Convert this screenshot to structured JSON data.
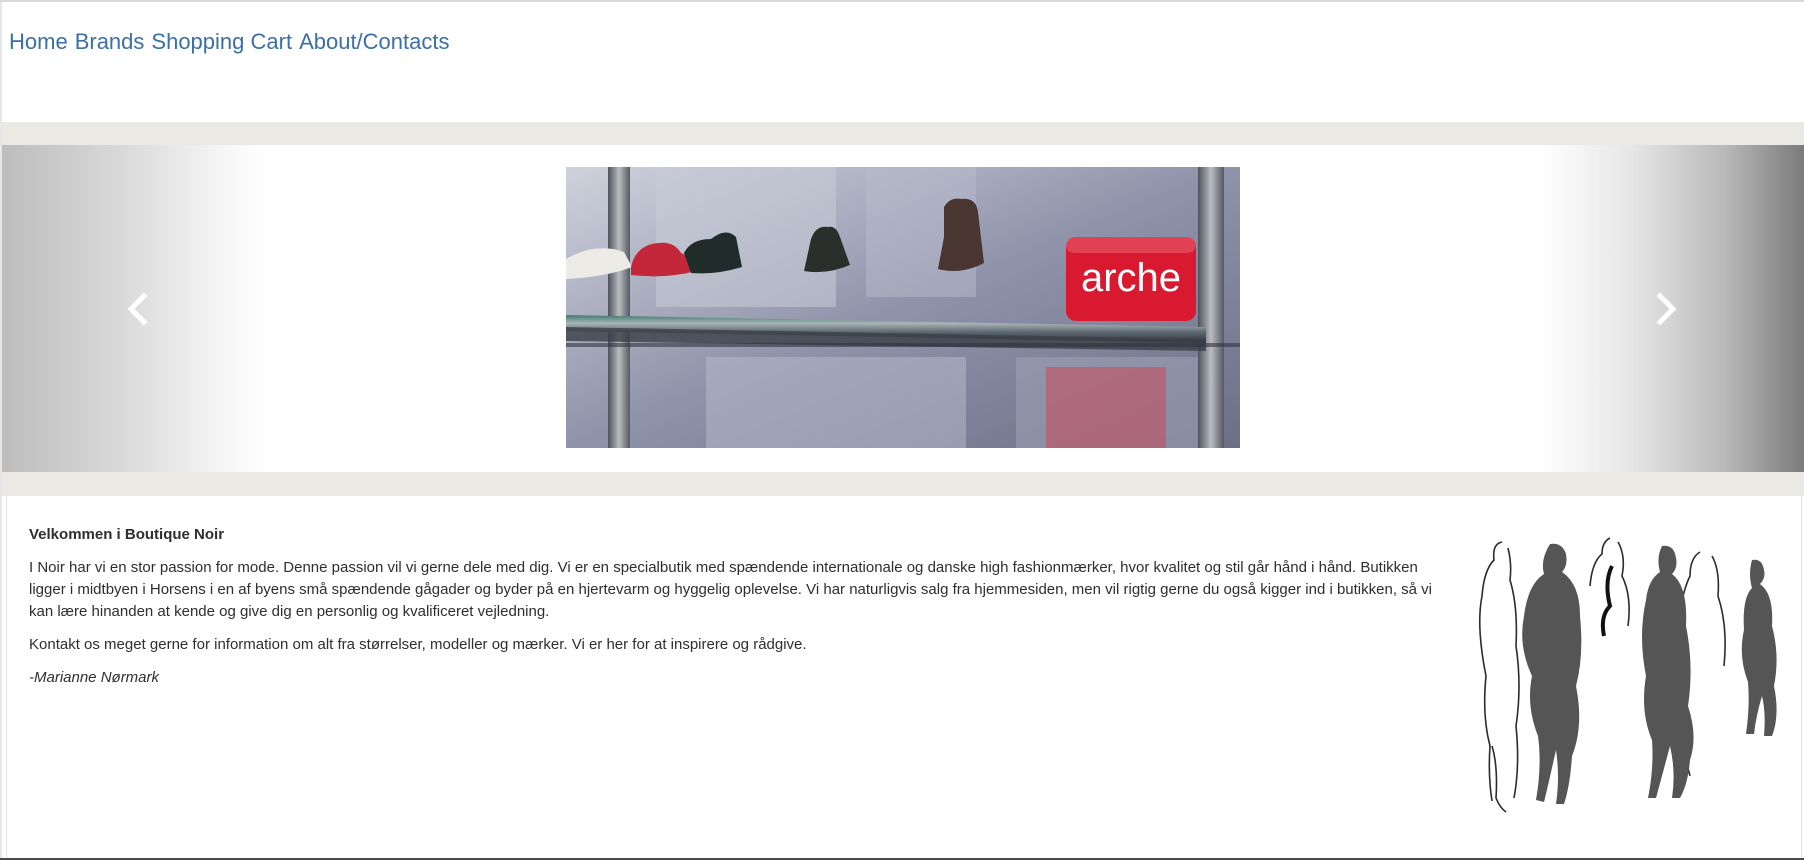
{
  "nav": {
    "items": [
      {
        "label": "Home"
      },
      {
        "label": "Brands"
      },
      {
        "label": "Shopping Cart"
      },
      {
        "label": "About/Contacts"
      }
    ]
  },
  "carousel": {
    "slide_brand_sign": "arche",
    "prev_icon": "chevron-left-icon",
    "next_icon": "chevron-right-icon"
  },
  "welcome": {
    "heading": "Velkommen i Boutique Noir",
    "paragraph_1": "I Noir har vi en stor passion for mode. Denne passion vil vi gerne dele med dig. Vi er en specialbutik med spændende internationale og danske high fashionmærker, hvor kvalitet og stil går hånd i hånd. Butikken ligger i midtbyen i Horsens i en af byens små spændende gågader og byder på en hjertevarm og hyggelig oplevelse. Vi har naturligvis salg fra hjemmesiden, men vil rigtig gerne du også kigger ind i butikken, så vi kan lære hinanden at kende og give dig en personlig og kvalificeret vejledning.",
    "paragraph_2": "Kontakt os meget gerne for information om alt fra størrelser, modeller og mærker. Vi er her for at inspirere og rådgive.",
    "signature": "-Marianne Nørmark"
  },
  "colors": {
    "link": "#3a6fa8",
    "band": "#ebe9e3",
    "sign_red": "#d8192f"
  }
}
